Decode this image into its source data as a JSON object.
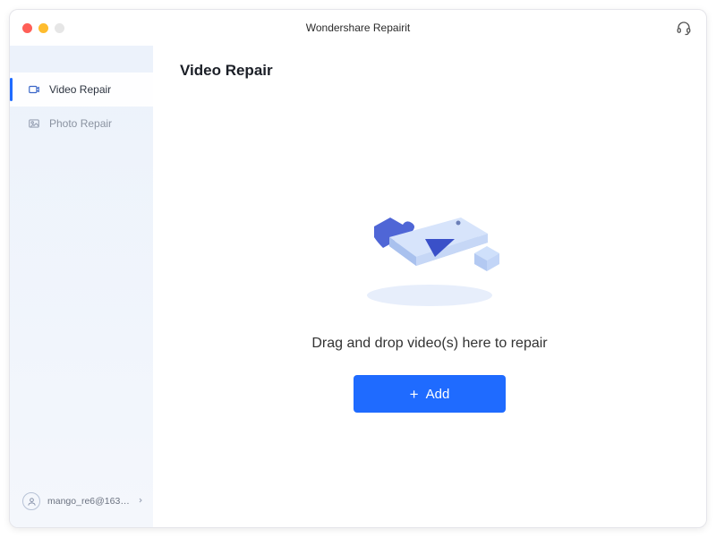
{
  "app": {
    "title": "Wondershare Repairit"
  },
  "sidebar": {
    "items": [
      {
        "label": "Video Repair",
        "icon": "video-repair-icon",
        "active": true
      },
      {
        "label": "Photo Repair",
        "icon": "photo-repair-icon",
        "active": false
      }
    ],
    "account": {
      "username": "mango_re6@163....",
      "icon": "user-avatar-icon"
    }
  },
  "main": {
    "page_title": "Video Repair",
    "drop_text": "Drag and drop video(s) here to repair",
    "add_button_label": "Add"
  },
  "colors": {
    "accent": "#1f6bff"
  }
}
